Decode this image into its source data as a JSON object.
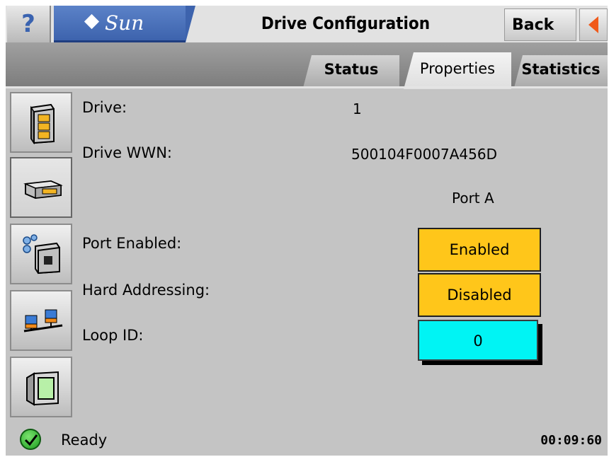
{
  "header": {
    "help_label": "?",
    "logo_text": "Sun",
    "title": "Drive Configuration",
    "back_label": "Back"
  },
  "tabs": [
    {
      "label": "Status",
      "active": false
    },
    {
      "label": "Properties",
      "active": true
    },
    {
      "label": "Statistics",
      "active": false
    }
  ],
  "sidebar": {
    "items": [
      {
        "icon": "library-icon",
        "active": false
      },
      {
        "icon": "drive-icon",
        "active": true
      },
      {
        "icon": "port-icon",
        "active": false
      },
      {
        "icon": "network-icon",
        "active": false
      },
      {
        "icon": "display-icon",
        "active": false
      }
    ]
  },
  "properties": {
    "drive_label": "Drive:",
    "drive_value": "1",
    "wwn_label": "Drive WWN:",
    "wwn_value": "500104F0007A456D",
    "port_header": "Port A",
    "port_enabled_label": "Port Enabled:",
    "port_enabled_value": "Enabled",
    "hard_addressing_label": "Hard Addressing:",
    "hard_addressing_value": "Disabled",
    "loop_id_label": "Loop ID:",
    "loop_id_value": "0"
  },
  "status": {
    "text": "Ready",
    "time": "00:09:60"
  },
  "colors": {
    "toggle_yellow": "#ffc61a",
    "input_cyan": "#00f4f4",
    "back_arrow": "#f05a1a",
    "logo_blue": "#3d63ad"
  }
}
